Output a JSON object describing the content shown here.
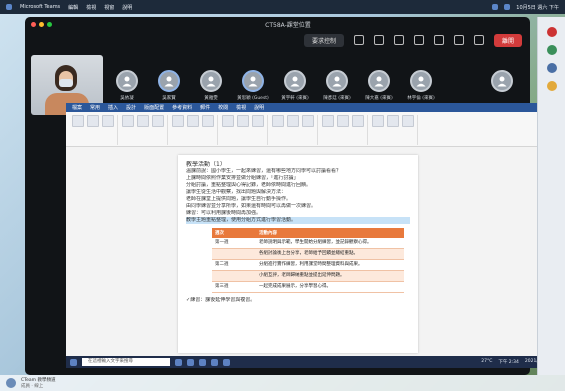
{
  "mac_menu": {
    "app": "Microsoft Teams",
    "items": [
      "編輯",
      "檢視",
      "視窗",
      "說明"
    ],
    "clock": "10月5日 週六 下午"
  },
  "meeting": {
    "title": "CT58A-課堂位置",
    "share_label": "要求控制",
    "leave_label": "離開",
    "participants": [
      {
        "name": "吳依凝",
        "active": false
      },
      {
        "name": "吳家賢",
        "active": true
      },
      {
        "name": "黃雅雯",
        "active": false
      },
      {
        "name": "黃思穎 (Guest)",
        "active": true
      },
      {
        "name": "黃宇軒 (來賓)",
        "active": false
      },
      {
        "name": "陳彥廷 (來賓)",
        "active": false
      },
      {
        "name": "陳大嘉 (來賓)",
        "active": false
      },
      {
        "name": "林宇倫 (來賓)",
        "active": false
      }
    ],
    "far_participant": " "
  },
  "word": {
    "tabs": [
      "檔案",
      "常用",
      "插入",
      "設計",
      "版面配置",
      "參考資料",
      "郵件",
      "校閱",
      "檢視",
      "說明"
    ],
    "heading": "教學活動（1）",
    "lines": [
      "溫課前說：國小學生，一起來練習，還有哪些地方同學可以討論看看？",
      "上課時間依照作業安排並做分組練習，「進行討論」",
      "分組討論，重點整理與心得記錄，老師依時間進行回饋。",
      "讓學生從生活中觀察，找出問題與解決方法：",
      "老師在課堂上提供問題，讓學生自行動手操作。",
      "由同學練習並分享所學，如果還有時間可以再做一次練習。",
      "練習：可以利用課後時間再加強。"
    ],
    "highlight_line": "教學主題重點整理，使用分組方式進行學習活動。",
    "table": {
      "headers": [
        "週次",
        "活動內容"
      ],
      "rows": [
        {
          "week": "第一週",
          "content": "老師說明與示範，學生開始分組練習，並記錄觀察心得。"
        },
        {
          "week": "",
          "content": "各組討論後上台分享，老師給予回饋並總結重點。"
        },
        {
          "week": "第二週",
          "content": "分組進行實作練習，利用課堂時間整理資料與成果。"
        },
        {
          "week": "",
          "content": "小組互評，老師歸納重點並提出延伸問題。"
        },
        {
          "week": "第三週",
          "content": "一起完成成果展示，分享學習心得。"
        }
      ]
    },
    "footer_line": "✓練習：課後延伸學習與複習。"
  },
  "taskbar": {
    "search_placeholder": "在這裡輸入文字來搜尋",
    "weather": "27°C",
    "time": "下午 2:34",
    "date": "2021/10/5"
  },
  "dock": {
    "name": "CTeam 教學頻道",
    "sub": "成員 · 線上"
  }
}
